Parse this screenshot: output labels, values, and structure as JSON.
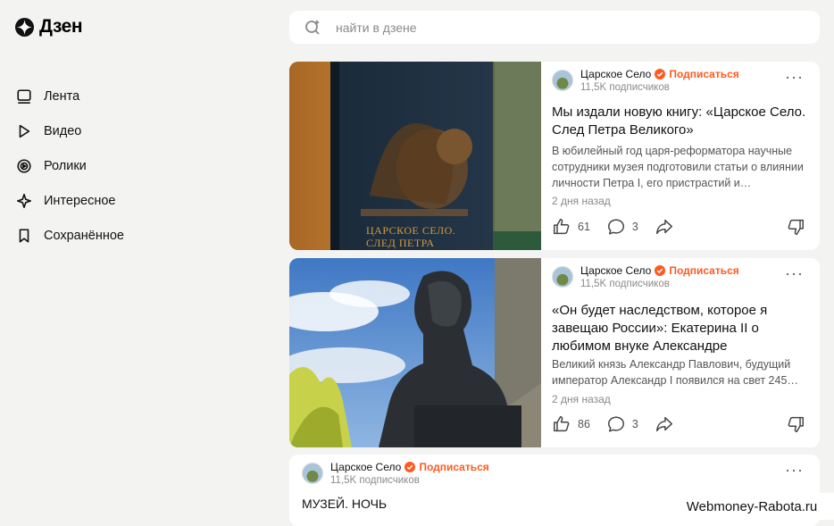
{
  "app": {
    "logo_text": "Дзен"
  },
  "search": {
    "placeholder": "найти в дзене",
    "value": ""
  },
  "sidebar": {
    "items": [
      {
        "label": "Лента",
        "icon": "feed-icon"
      },
      {
        "label": "Видео",
        "icon": "play-icon"
      },
      {
        "label": "Ролики",
        "icon": "shorts-icon"
      },
      {
        "label": "Интересное",
        "icon": "interesting-icon"
      },
      {
        "label": "Сохранённое",
        "icon": "bookmark-icon"
      }
    ]
  },
  "feed": [
    {
      "channel": "Царское Село",
      "subscribe": "Подписаться",
      "subscribers": "11,5K подписчиков",
      "title": "Мы издали новую книгу: «Царское Село. След Петра Великого»",
      "description": "В юбилейный год царя-реформатора научные сотрудники музея подготовили статьи о влиянии личности Петра I, его пристрастий и…",
      "date": "2 дня назад",
      "likes": "61",
      "comments": "3",
      "image_caption": "ЦАРСКОЕ СЕЛО. СЛЕД ПЕТРА ВЕЛИКОГО",
      "more": "···"
    },
    {
      "channel": "Царское Село",
      "subscribe": "Подписаться",
      "subscribers": "11,5K подписчиков",
      "title": "«Он будет наследством, которое я завещаю России»: Екатерина II о любимом внуке Александре",
      "description": "Великий князь Александр Павлович, будущий император Александр I появился на свет 245…",
      "date": "2 дня назад",
      "likes": "86",
      "comments": "3",
      "more": "···"
    },
    {
      "channel": "Царское Село",
      "subscribe": "Подписаться",
      "subscribers": "11,5K подписчиков",
      "title": "МУЗЕЙ. НОЧЬ",
      "more": "···"
    }
  ],
  "watermark": "Webmoney-Rabota.ru",
  "colors": {
    "accent": "#ff5a1f",
    "background": "#f3f3f2",
    "card": "#ffffff"
  }
}
